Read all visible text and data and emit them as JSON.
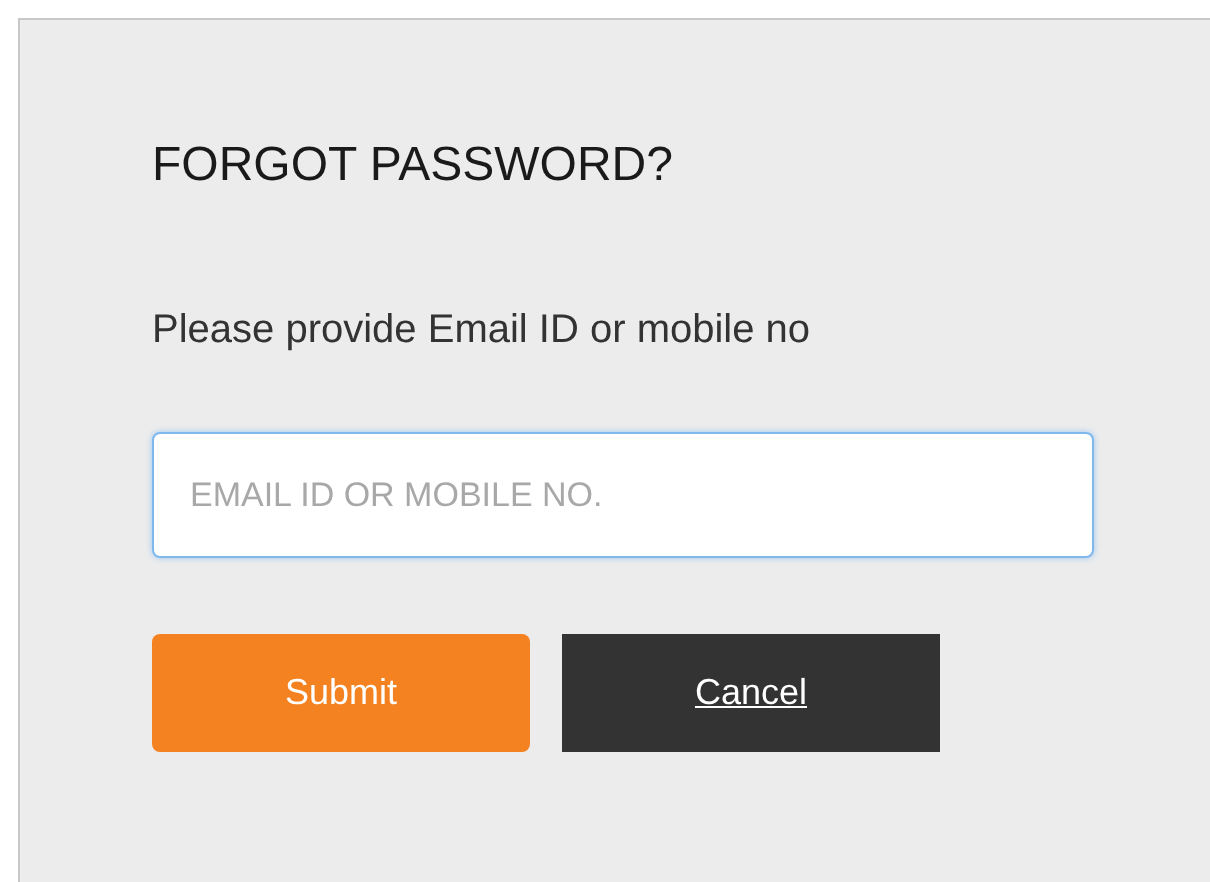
{
  "title": "FORGOT PASSWORD?",
  "instruction": "Please provide Email ID or mobile no",
  "field": {
    "placeholder": "EMAIL ID OR MOBILE NO.",
    "focused": true
  },
  "buttons": [
    {
      "kind": "primary",
      "label": "Submit"
    },
    {
      "kind": "secondary",
      "label": "Cancel"
    }
  ]
}
